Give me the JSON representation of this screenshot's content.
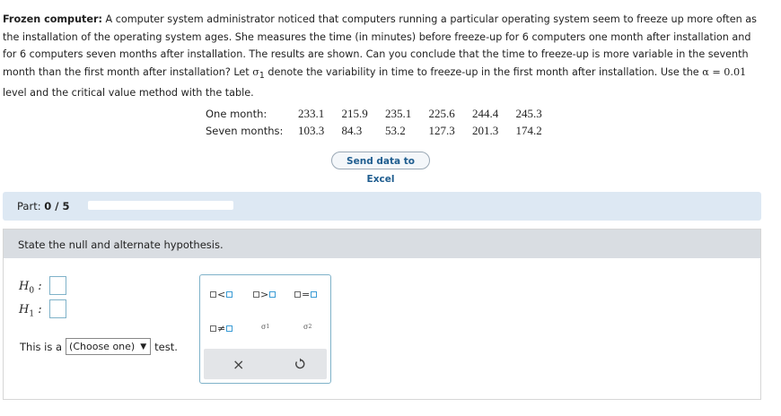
{
  "problem": {
    "title": "Frozen computer:",
    "text_1": " A computer system administrator noticed that computers running a particular operating system seem to freeze up more often as the installation of the operating system ages. She measures the time (in minutes) before freeze-up for ",
    "n1": "6",
    "text_2": " computers one month after installation and for ",
    "n2": "6",
    "text_3": " computers seven months after installation. The results are shown. Can you conclude that the time to freeze-up is more variable in the seventh month than the first month after installation? Let ",
    "sigma1": "σ",
    "sigma1_sub": "1",
    "text_4": " denote the variability in time to freeze-up in the first month after installation. Use the ",
    "alpha_eq": "α = 0.01",
    "text_5": " level and the critical value method with the table."
  },
  "data_table": {
    "rows": [
      {
        "label": "One month:",
        "values": [
          "233.1",
          "215.9",
          "235.1",
          "225.6",
          "244.4",
          "245.3"
        ]
      },
      {
        "label": "Seven months:",
        "values": [
          "103.3",
          "84.3",
          "53.2",
          "127.3",
          "201.3",
          "174.2"
        ]
      }
    ]
  },
  "send_button": "Send data to Excel",
  "part": {
    "label": "Part:",
    "value": "0 / 5",
    "progress": 0
  },
  "section": {
    "heading": "State the null and alternate hypothesis."
  },
  "hypotheses": {
    "h0": "H",
    "h0_sub": "0",
    "h1": "H",
    "h1_sub": "1",
    "colon": ":"
  },
  "test_line": {
    "prefix": "This is a",
    "select_value": "(Choose one)",
    "suffix": "test."
  },
  "palette": {
    "lt": "<",
    "gt": ">",
    "eq": "=",
    "neq": "≠",
    "sigma1": "σ",
    "sigma1_sub": "1",
    "sigma2": "σ",
    "sigma2_sub": "2",
    "clear": "×"
  },
  "colors": {
    "accent": "#3a9bd5",
    "part_bar": "#dde8f3",
    "section_head": "#d9dde2"
  }
}
